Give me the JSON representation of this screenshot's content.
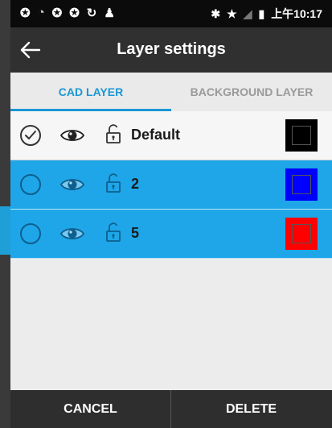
{
  "status_bar": {
    "left_icons": [
      "sync-icon",
      "wifi-icon",
      "sync-icon",
      "sync-icon",
      "refresh-icon",
      "android-icon"
    ],
    "right_icons": [
      "bluetooth-icon",
      "star-icon",
      "no-signal-icon",
      "battery-icon"
    ],
    "time": "上午10:17"
  },
  "app_bar": {
    "title": "Layer settings",
    "back_icon": "arrow-left-icon"
  },
  "tabs": [
    {
      "label": "CAD LAYER",
      "active": true
    },
    {
      "label": "BACKGROUND LAYER",
      "active": false
    }
  ],
  "layers": [
    {
      "name": "Default",
      "checked": true,
      "selected": false,
      "color": "#000000"
    },
    {
      "name": "2",
      "checked": false,
      "selected": true,
      "color": "#0000ff"
    },
    {
      "name": "5",
      "checked": false,
      "selected": true,
      "color": "#ff0000"
    }
  ],
  "footer": {
    "cancel_label": "CANCEL",
    "delete_label": "DELETE"
  },
  "colors": {
    "accent": "#1a97d4",
    "selected_row": "#1ea6e8",
    "app_bar": "#303030",
    "status_bar": "#0b0b0b"
  }
}
